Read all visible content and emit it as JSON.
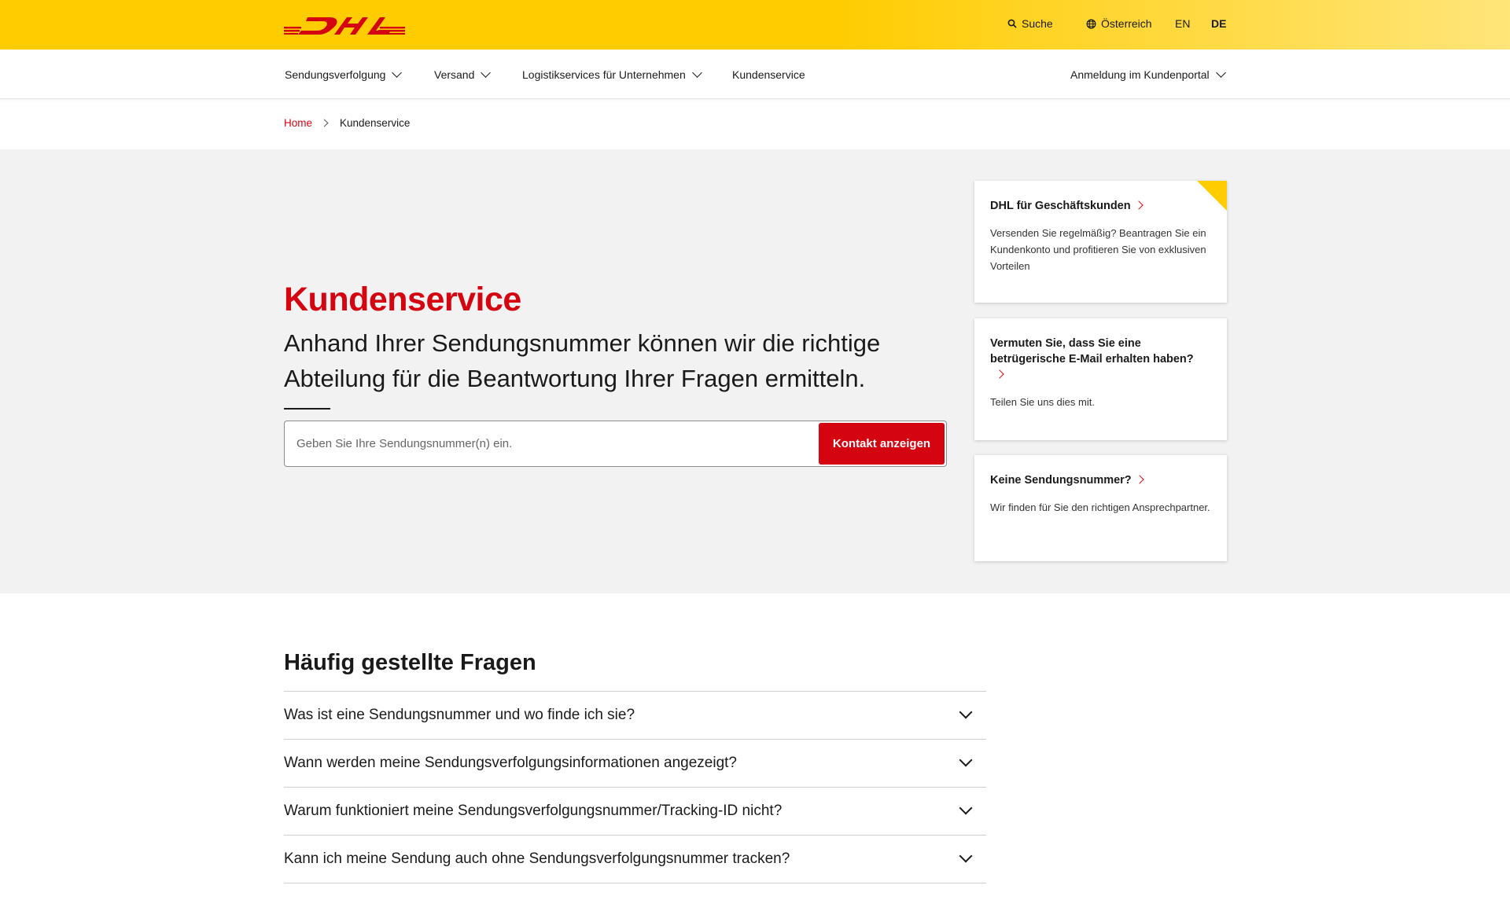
{
  "header": {
    "logo_text": "DHL",
    "search_label": "Suche",
    "country_label": "Österreich",
    "lang_en": "EN",
    "lang_de": "DE",
    "brand_yellow": "#ffcc00",
    "brand_red": "#d40511"
  },
  "nav": {
    "items": [
      {
        "label": "Sendungsverfolgung",
        "has_dropdown": true
      },
      {
        "label": "Versand",
        "has_dropdown": true
      },
      {
        "label": "Logistikservices für Unternehmen",
        "has_dropdown": true
      },
      {
        "label": "Kundenservice",
        "has_dropdown": false
      }
    ],
    "login_label": "Anmeldung im Kundenportal"
  },
  "breadcrumb": {
    "home": "Home",
    "current": "Kundenservice"
  },
  "hero": {
    "title": "Kundenservice",
    "subtitle": "Anhand Ihrer Sendungsnummer können wir die richtige Abteilung für die Beantwortung Ihrer Fragen ermitteln.",
    "input_placeholder": "Geben Sie Ihre Sendungsnummer(n) ein.",
    "button_label": "Kontakt anzeigen"
  },
  "cards": [
    {
      "title": "DHL für Geschäftskunden",
      "text": "Versenden Sie regelmäßig? Beantragen Sie ein Kundenkonto und profitieren Sie von exklusiven Vorteilen"
    },
    {
      "title": "Vermuten Sie, dass Sie eine betrügerische E-Mail erhalten haben?",
      "text": "Teilen Sie uns dies mit."
    },
    {
      "title": "Keine Sendungsnummer?",
      "text": "Wir finden für Sie den richtigen Ansprechpartner."
    }
  ],
  "faq": {
    "title": "Häufig gestellte Fragen",
    "items": [
      "Was ist eine Sendungsnummer und wo finde ich sie?",
      "Wann werden meine Sendungsverfolgungsinformationen angezeigt?",
      "Warum funktioniert meine Sendungsverfolgungsnummer/Tracking-ID nicht?",
      "Kann ich meine Sendung auch ohne Sendungsverfolgungsnummer tracken?"
    ]
  }
}
